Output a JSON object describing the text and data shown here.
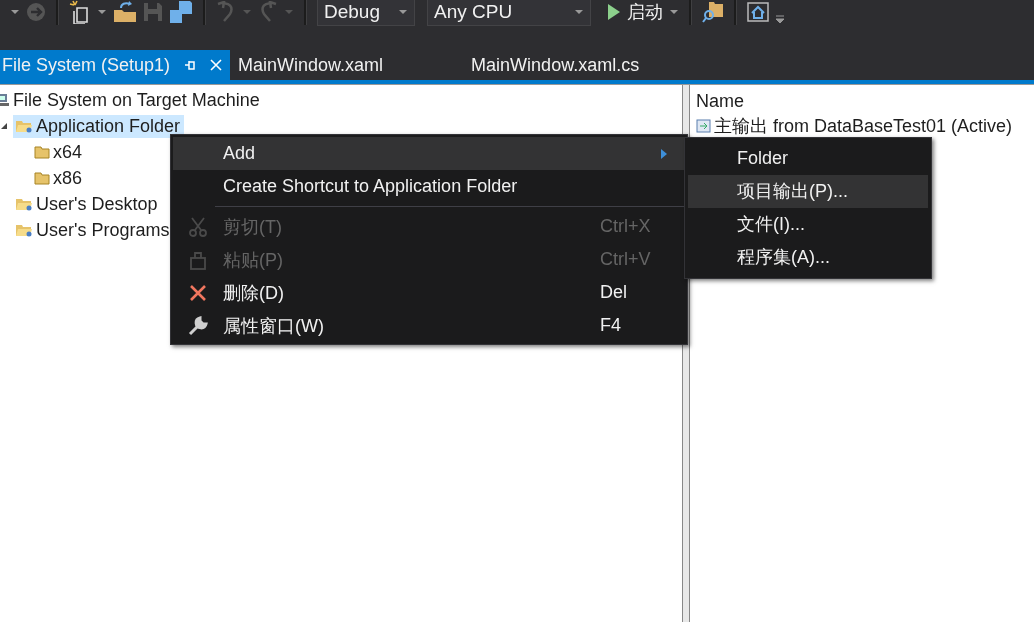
{
  "toolbar": {
    "configuration": "Debug",
    "platform": "Any CPU",
    "start": "启动"
  },
  "tabs": [
    {
      "label": "File System (Setup1)",
      "selected": true
    },
    {
      "label": "MainWindow.xaml",
      "selected": false
    },
    {
      "label": "MainWindow.xaml.cs",
      "selected": false
    }
  ],
  "tree": [
    {
      "label": "File System on Target Machine",
      "kind": "machine",
      "selected": false,
      "children": [
        {
          "label": "Application Folder",
          "kind": "special",
          "selected": true,
          "expanded": true,
          "children": [
            {
              "label": "x64",
              "kind": "folder",
              "selected": false
            },
            {
              "label": "x86",
              "kind": "folder",
              "selected": false
            }
          ]
        },
        {
          "label": "User's Desktop",
          "kind": "special",
          "selected": false
        },
        {
          "label": "User's Programs",
          "kind": "special",
          "selected": false
        }
      ]
    }
  ],
  "details": {
    "header": "Name",
    "rows": [
      "主输出 from DataBaseTest01 (Active)"
    ]
  },
  "context_menu": [
    {
      "kind": "submenu",
      "label": "Add",
      "selected": true,
      "disabled": false
    },
    {
      "kind": "plain",
      "label": "Create Shortcut to Application Folder",
      "selected": false,
      "disabled": false
    },
    {
      "kind": "separator"
    },
    {
      "kind": "cut",
      "label": "剪切(T)",
      "shortcut": "Ctrl+X",
      "selected": false,
      "disabled": true
    },
    {
      "kind": "paste",
      "label": "粘贴(P)",
      "shortcut": "Ctrl+V",
      "selected": false,
      "disabled": true
    },
    {
      "kind": "delete",
      "label": "删除(D)",
      "shortcut": "Del",
      "selected": false,
      "disabled": false
    },
    {
      "kind": "properties",
      "label": "属性窗口(W)",
      "shortcut": "F4",
      "selected": false,
      "disabled": false
    }
  ],
  "submenu": [
    {
      "label": "Folder",
      "selected": false
    },
    {
      "label": "项目输出(P)...",
      "selected": true
    },
    {
      "label": "文件(I)...",
      "selected": false
    },
    {
      "label": "程序集(A)...",
      "selected": false
    }
  ]
}
